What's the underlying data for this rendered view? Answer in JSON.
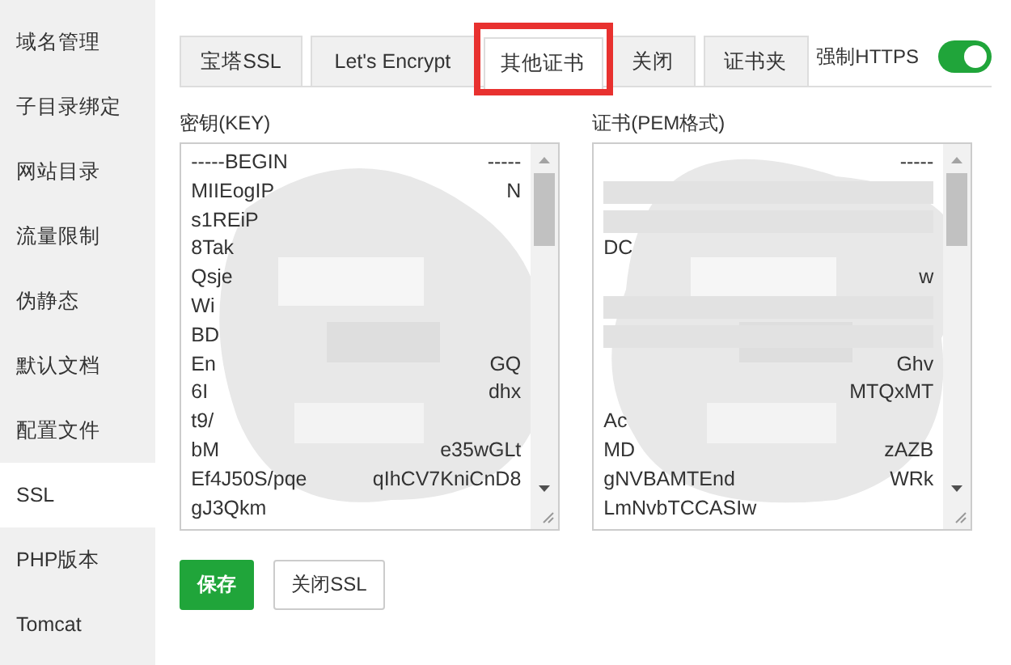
{
  "sidebar": {
    "items": [
      {
        "label": "域名管理",
        "selected": false
      },
      {
        "label": "子目录绑定",
        "selected": false
      },
      {
        "label": "网站目录",
        "selected": false
      },
      {
        "label": "流量限制",
        "selected": false
      },
      {
        "label": "伪静态",
        "selected": false
      },
      {
        "label": "默认文档",
        "selected": false
      },
      {
        "label": "配置文件",
        "selected": false
      },
      {
        "label": "SSL",
        "selected": true
      },
      {
        "label": "PHP版本",
        "selected": false
      },
      {
        "label": "Tomcat",
        "selected": false
      }
    ]
  },
  "tabs": [
    {
      "label": "宝塔SSL",
      "selected": false,
      "highlighted": false
    },
    {
      "label": "Let's Encrypt",
      "selected": false,
      "highlighted": false
    },
    {
      "label": "其他证书",
      "selected": true,
      "highlighted": true
    },
    {
      "label": "关闭",
      "selected": false,
      "highlighted": false
    },
    {
      "label": "证书夹",
      "selected": false,
      "highlighted": false
    }
  ],
  "force_https": {
    "label": "强制HTTPS",
    "on": true
  },
  "fields": [
    {
      "label": "密钥(KEY)",
      "lines": [
        {
          "start": "-----BEGIN",
          "end": "-----"
        },
        {
          "start": "MIIEogIP",
          "end": "N"
        },
        {
          "start": "s1REiP"
        },
        {
          "start": "8Tak"
        },
        {
          "start": "Qsje"
        },
        {
          "start": "Wi"
        },
        {
          "start": "BD"
        },
        {
          "start": "En",
          "end": "GQ"
        },
        {
          "start": "6I",
          "end": "dhx"
        },
        {
          "start": "t9/"
        },
        {
          "start": "bM",
          "end": "e35wGLt"
        },
        {
          "start": "Ef4J50S/pqe",
          "end": "qIhCV7KniCnD8"
        },
        {
          "start": "gJ3Qkm"
        }
      ]
    },
    {
      "label": "证书(PEM格式)",
      "lines": [
        {
          "end": "-----"
        },
        {
          "covered": true
        },
        {
          "covered": true
        },
        {
          "start": "DC"
        },
        {
          "end": "w"
        },
        {
          "covered": true
        },
        {
          "covered": true
        },
        {
          "end": "Ghv"
        },
        {
          "end": "MTQxMT"
        },
        {
          "start": "Ac"
        },
        {
          "start": "MD",
          "end": "zAZB"
        },
        {
          "start": "gNVBAMTEnd",
          "end": "WRk"
        },
        {
          "start": "LmNvbTCCASIw"
        }
      ]
    }
  ],
  "buttons": [
    {
      "label": "保存",
      "kind": "primary"
    },
    {
      "label": "关闭SSL",
      "kind": "default"
    }
  ]
}
